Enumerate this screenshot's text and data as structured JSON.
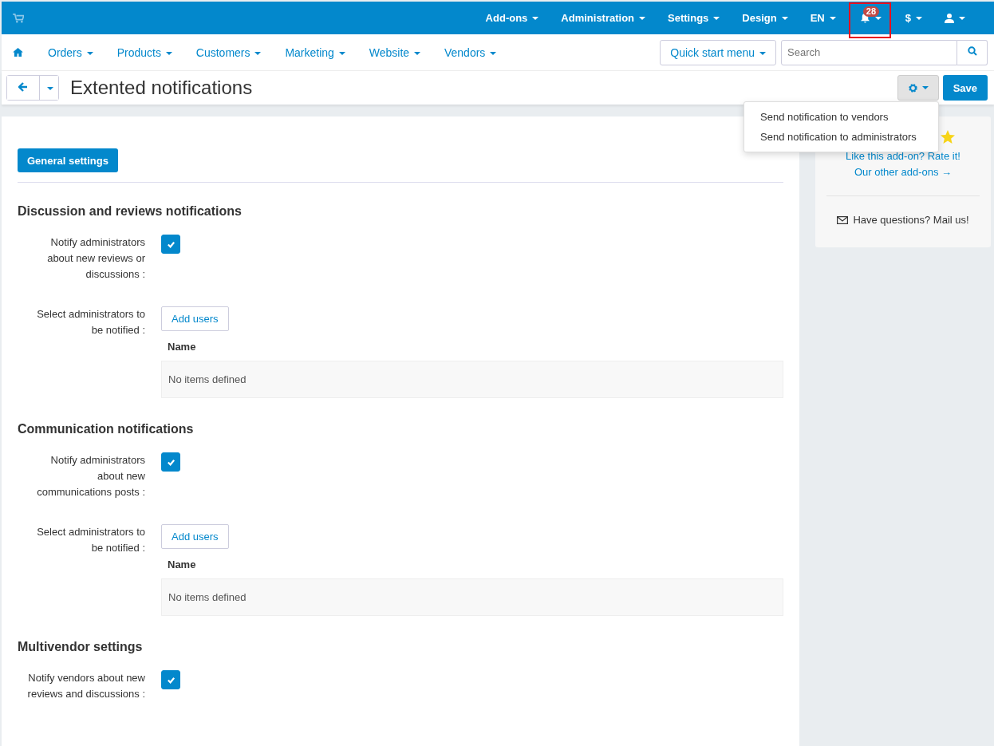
{
  "top_menu": [
    {
      "label": "Add-ons"
    },
    {
      "label": "Administration"
    },
    {
      "label": "Settings"
    },
    {
      "label": "Design"
    },
    {
      "label": "EN"
    }
  ],
  "notifications": {
    "count": "28",
    "highlighted": true
  },
  "currency": {
    "label": "$"
  },
  "nav": [
    {
      "label": "Orders"
    },
    {
      "label": "Products"
    },
    {
      "label": "Customers"
    },
    {
      "label": "Marketing"
    },
    {
      "label": "Website"
    },
    {
      "label": "Vendors"
    }
  ],
  "quick_start": "Quick start menu",
  "search": {
    "placeholder": "Search"
  },
  "page_title": "Extented notifications",
  "save": "Save",
  "gear_menu": {
    "expanded": true,
    "items": [
      "Send notification to vendors",
      "Send notification to administrators"
    ]
  },
  "tabs": [
    {
      "label": "General settings",
      "selected": true
    }
  ],
  "sections": [
    {
      "title": "Discussion and reviews notifications",
      "fields": [
        {
          "kind": "checkbox",
          "label": "Notify administrators about new reviews or discussions :",
          "checked": true
        },
        {
          "kind": "users",
          "label": "Select administrators to be notified :",
          "button": "Add users",
          "column": "Name",
          "empty": "No items defined"
        }
      ]
    },
    {
      "title": "Communication notifications",
      "fields": [
        {
          "kind": "checkbox",
          "label": "Notify administrators about new communications posts :",
          "checked": true
        },
        {
          "kind": "users",
          "label": "Select administrators to be notified :",
          "button": "Add users",
          "column": "Name",
          "empty": "No items defined"
        }
      ]
    },
    {
      "title": "Multivendor settings",
      "fields": [
        {
          "kind": "checkbox",
          "label": "Notify vendors about new reviews and discussions :",
          "checked": true
        }
      ]
    }
  ],
  "sidebar": {
    "rate_link": "Like this add-on? Rate it!",
    "other_link": "Our other add-ons →",
    "mail": "Have questions? Mail us!"
  }
}
